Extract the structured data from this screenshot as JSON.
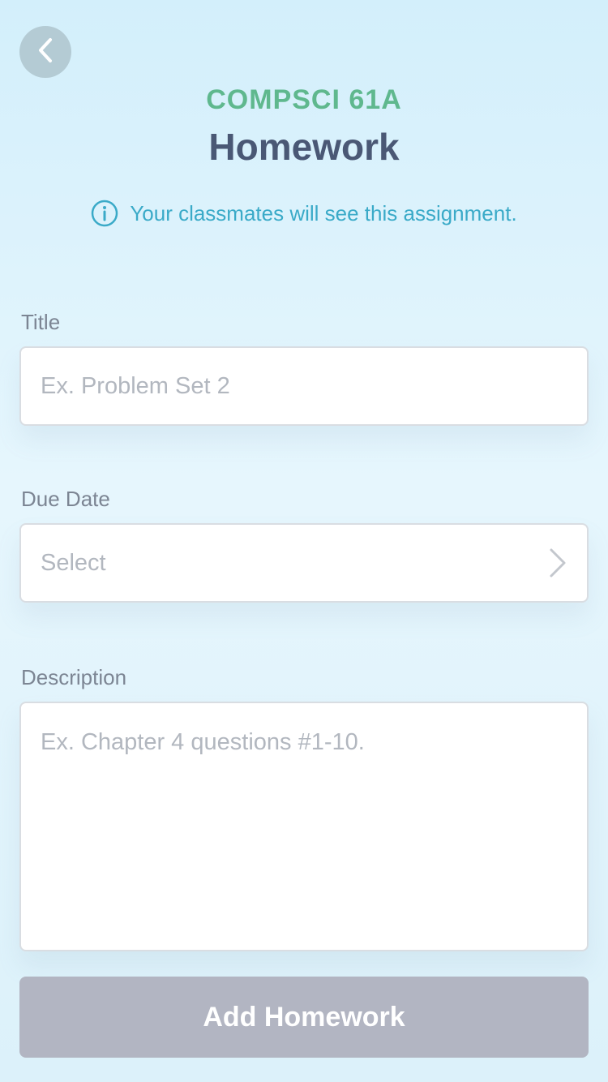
{
  "header": {
    "course_code": "COMPSCI 61A",
    "title": "Homework",
    "notice": "Your classmates will see this assignment."
  },
  "form": {
    "title_field": {
      "label": "Title",
      "placeholder": "Ex. Problem Set 2",
      "value": ""
    },
    "due_date_field": {
      "label": "Due Date",
      "value": "Select"
    },
    "description_field": {
      "label": "Description",
      "placeholder": "Ex. Chapter 4 questions #1-10.",
      "value": ""
    }
  },
  "submit": {
    "label": "Add Homework"
  },
  "icons": {
    "back": "chevron-left-icon",
    "info": "info-circle-icon",
    "disclosure": "chevron-right-icon"
  },
  "colors": {
    "accent_green": "#5fb88e",
    "title_navy": "#4a5875",
    "notice_blue": "#3aaac8",
    "button_disabled": "#b2b5c2",
    "back_button_bg": "#b4cbd4"
  }
}
